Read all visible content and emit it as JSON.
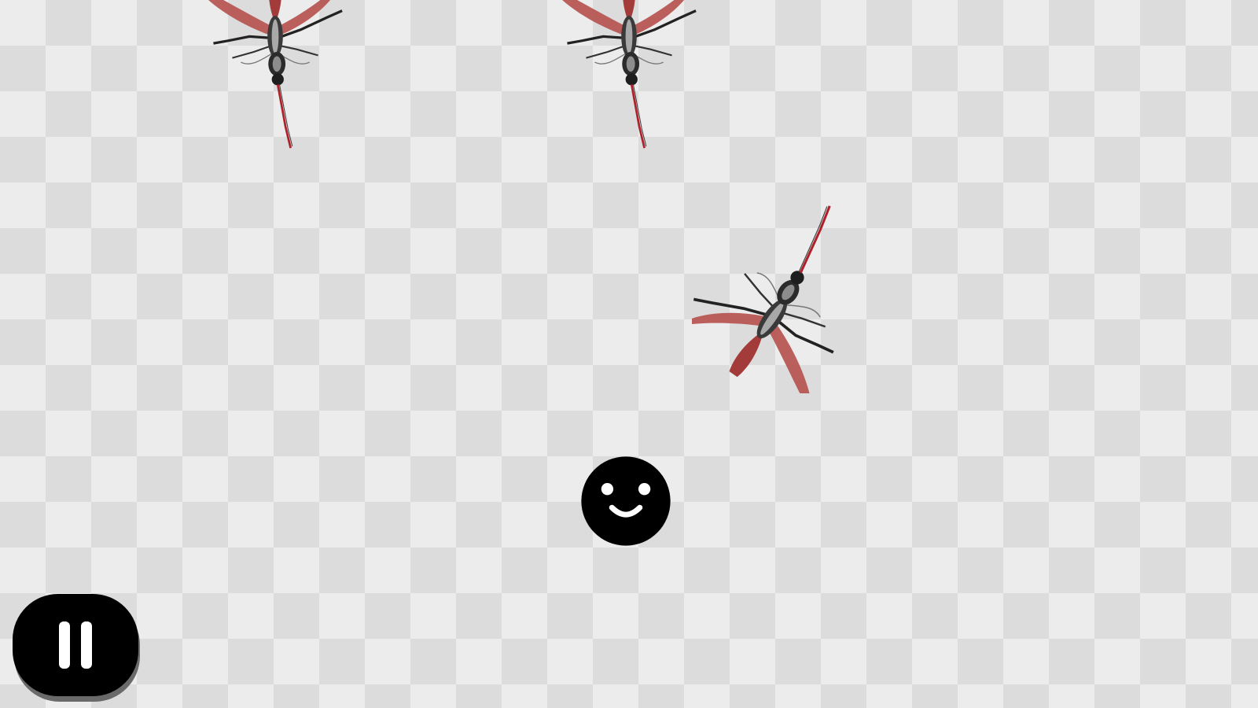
{
  "game": {
    "sprites": {
      "player": "smiley-face-icon",
      "enemy": "mosquito-icon"
    },
    "enemy_count": 3
  },
  "controls": {
    "pause_icon": "pause-icon"
  },
  "colors": {
    "background_light": "#ececec",
    "background_dark": "#dcdcdc",
    "wing": "#b5504c",
    "body": "#2b2b2b",
    "proboscis": "#b0202a",
    "player": "#000000",
    "button": "#000000"
  }
}
